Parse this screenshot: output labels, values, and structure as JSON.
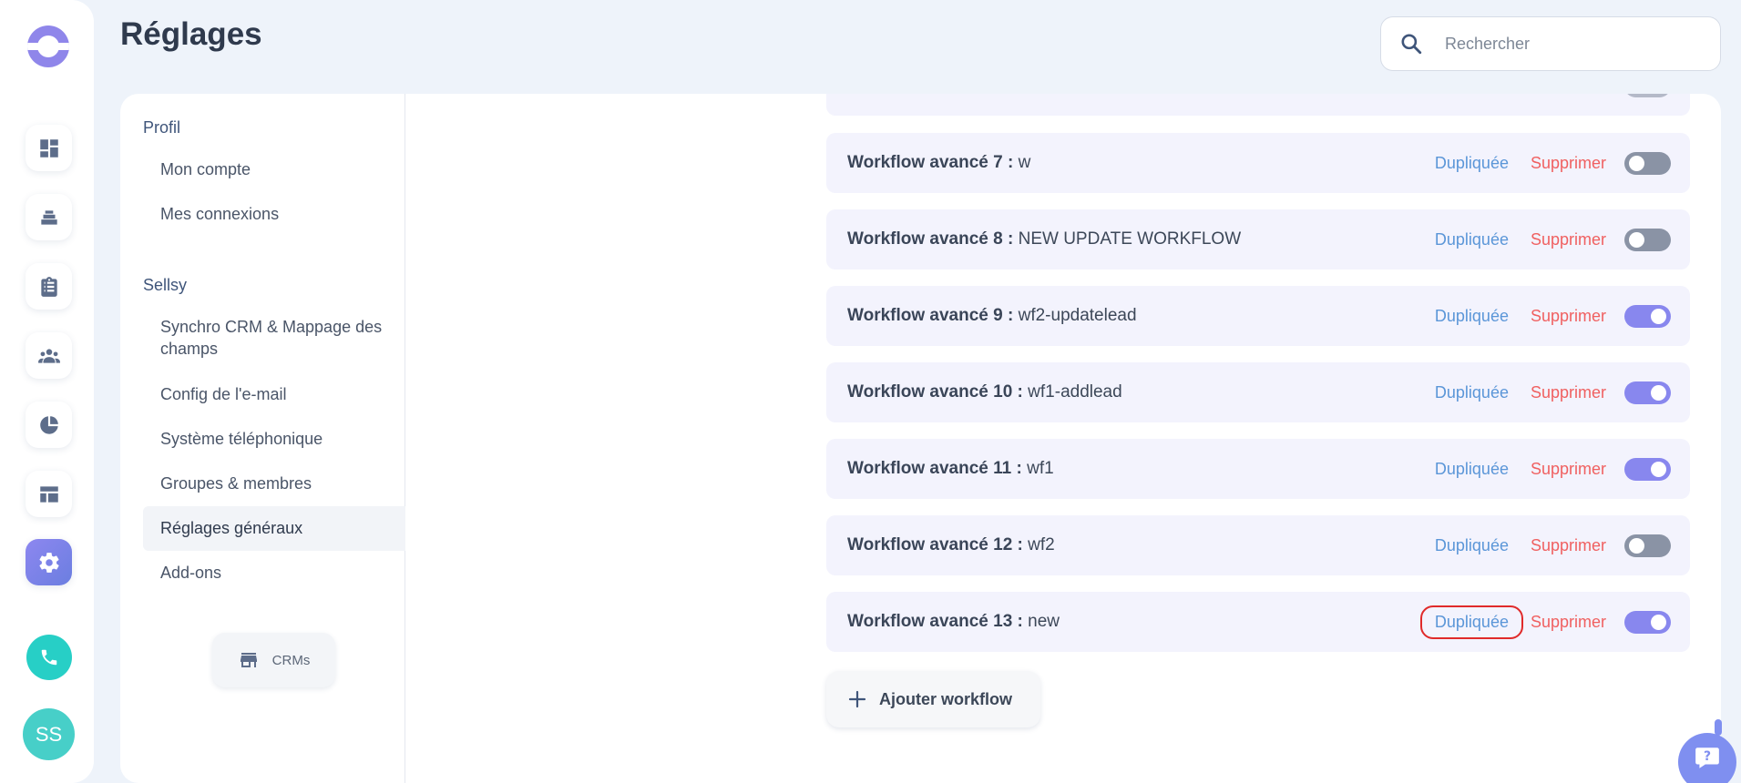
{
  "rail": {
    "nav_icons": [
      "dashboard-icon",
      "layers-icon",
      "clipboard-icon",
      "team-icon",
      "pie-chart-icon",
      "layout-icon",
      "gear-icon"
    ],
    "active": "gear-icon",
    "avatar_initials": "SS",
    "accent_color": "#8887ee",
    "call_color": "#27cfc6"
  },
  "header": {
    "title": "Réglages",
    "search_placeholder": "Rechercher"
  },
  "sidebar": {
    "sections": [
      {
        "title": "Profil",
        "items": [
          "Mon compte",
          "Mes connexions"
        ]
      },
      {
        "title": "Sellsy",
        "items": [
          "Synchro CRM & Mappage des champs",
          "Config de l'e-mail",
          "Système téléphonique",
          "Groupes & membres",
          "Réglages généraux",
          "Add-ons"
        ]
      }
    ],
    "active_item": "Réglages généraux",
    "crm_button_label": "CRMs"
  },
  "workflows": {
    "duplicate_label": "Dupliquée",
    "delete_label": "Supprimer",
    "rows": [
      {
        "label": "Workflow avancé 7 :",
        "name": "w",
        "enabled": false
      },
      {
        "label": "Workflow avancé 8 :",
        "name": "NEW UPDATE WORKFLOW",
        "enabled": false
      },
      {
        "label": "Workflow avancé 9 :",
        "name": "wf2-updatelead",
        "enabled": true
      },
      {
        "label": "Workflow avancé 10 :",
        "name": "wf1-addlead",
        "enabled": true
      },
      {
        "label": "Workflow avancé 11 :",
        "name": "wf1",
        "enabled": true
      },
      {
        "label": "Workflow avancé 12 :",
        "name": "wf2",
        "enabled": false
      },
      {
        "label": "Workflow avancé 13 :",
        "name": "new",
        "enabled": true
      }
    ],
    "add_label": "Ajouter workflow"
  },
  "colors": {
    "duplicate": "#5b96d8",
    "delete": "#f06060",
    "toggle_on": "#8887ee",
    "toggle_off": "#8a93a5",
    "highlight_outline": "#e02a2a"
  }
}
